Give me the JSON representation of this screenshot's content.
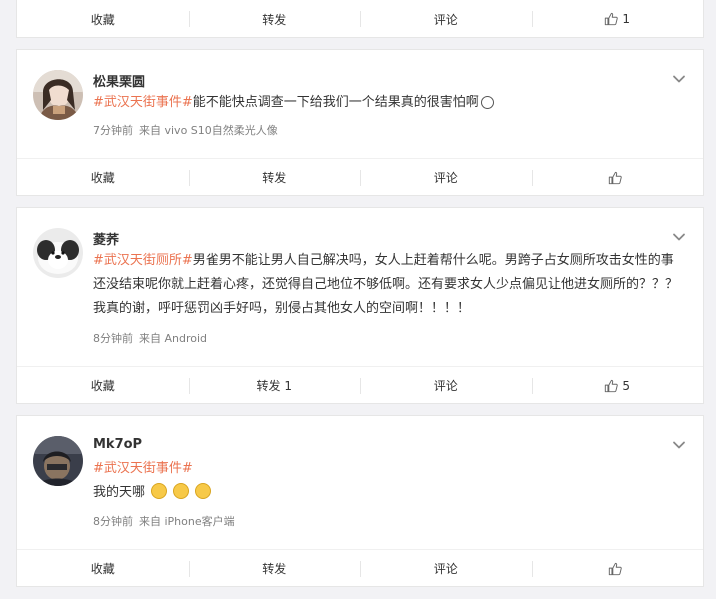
{
  "actions": {
    "collect": "收藏",
    "repost": "转发",
    "comment": "评论"
  },
  "top_bar": {
    "repost": "转发",
    "like_count": "1"
  },
  "posts": [
    {
      "username": "松果栗圆",
      "hashtag": "#武汉天街事件#",
      "text": "能不能快点调查一下给我们一个结果真的很害怕啊",
      "time": "7分钟前",
      "source": "来自 vivo S10自然柔光人像",
      "repost": "转发",
      "like_count": ""
    },
    {
      "username": "菱荞",
      "hashtag": "#武汉天街厕所#",
      "text": "男雀男不能让男人自己解决吗，女人上赶着帮什么呢。男跨子占女厕所攻击女性的事还没结束呢你就上赶着心疼，还觉得自己地位不够低啊。还有要求女人少点偏见让他进女厕所的？？？我真的谢，呼吁惩罚凶手好吗，别侵占其他女人的空间啊！！！！",
      "time": "8分钟前",
      "source": "来自 Android",
      "repost": "转发 1",
      "like_count": "5"
    },
    {
      "username": "Mk7oP",
      "hashtag": "#武汉天街事件#",
      "text": "我的天哪",
      "time": "8分钟前",
      "source": "来自 iPhone客户端",
      "repost": "转发",
      "like_count": ""
    }
  ],
  "colors": {
    "hashtag": "#eb7350",
    "background": "#f2f2f5",
    "meta": "#808080"
  },
  "icons": {
    "like": "thumbs-up-icon",
    "expand": "chevron-down-icon",
    "emoji_smile": "smile-emoji-icon",
    "emoji_cry": "crying-emoji-icon"
  }
}
